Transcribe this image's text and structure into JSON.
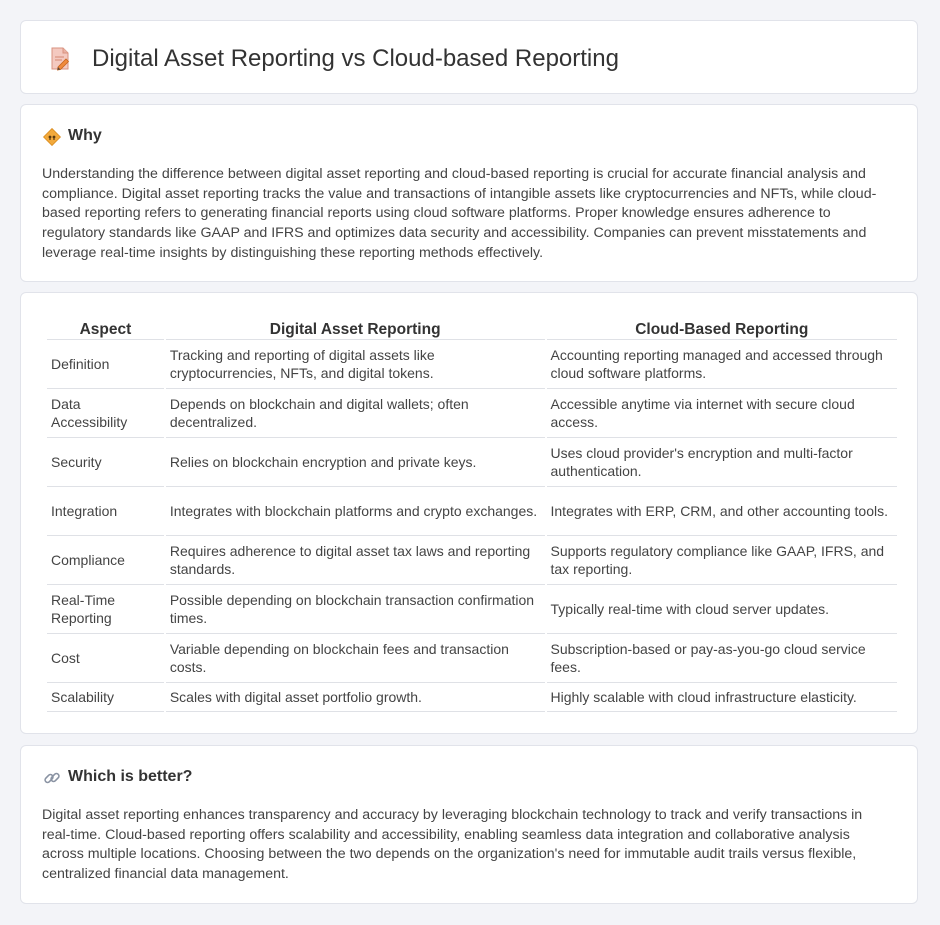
{
  "page": {
    "title": "Digital Asset Reporting vs Cloud-based Reporting"
  },
  "why": {
    "title": "Why",
    "text": "Understanding the difference between digital asset reporting and cloud-based reporting is crucial for accurate financial analysis and compliance. Digital asset reporting tracks the value and transactions of intangible assets like cryptocurrencies and NFTs, while cloud-based reporting refers to generating financial reports using cloud software platforms. Proper knowledge ensures adherence to regulatory standards like GAAP and IFRS and optimizes data security and accessibility. Companies can prevent misstatements and leverage real-time insights by distinguishing these reporting methods effectively."
  },
  "table": {
    "headers": [
      "Aspect",
      "Digital Asset Reporting",
      "Cloud-Based Reporting"
    ],
    "rows": [
      [
        "Definition",
        "Tracking and reporting of digital assets like cryptocurrencies, NFTs, and digital tokens.",
        "Accounting reporting managed and accessed through cloud software platforms."
      ],
      [
        "Data Accessibility",
        "Depends on blockchain and digital wallets; often decentralized.",
        "Accessible anytime via internet with secure cloud access."
      ],
      [
        "Security",
        "Relies on blockchain encryption and private keys.",
        "Uses cloud provider's encryption and multi-factor authentication."
      ],
      [
        "Integration",
        "Integrates with blockchain platforms and crypto exchanges.",
        "Integrates with ERP, CRM, and other accounting tools."
      ],
      [
        "Compliance",
        "Requires adherence to digital asset tax laws and reporting standards.",
        "Supports regulatory compliance like GAAP, IFRS, and tax reporting."
      ],
      [
        "Real-Time Reporting",
        "Possible depending on blockchain transaction confirmation times.",
        "Typically real-time with cloud server updates."
      ],
      [
        "Cost",
        "Variable depending on blockchain fees and transaction costs.",
        "Subscription-based or pay-as-you-go cloud service fees."
      ],
      [
        "Scalability",
        "Scales with digital asset portfolio growth.",
        "Highly scalable with cloud infrastructure elasticity."
      ]
    ]
  },
  "better": {
    "title": "Which is better?",
    "text": "Digital asset reporting enhances transparency and accuracy by leveraging blockchain technology to track and verify transactions in real-time. Cloud-based reporting offers scalability and accessibility, enabling seamless data integration and collaborative analysis across multiple locations. Choosing between the two depends on the organization's need for immutable audit trails versus flexible, centralized financial data management."
  },
  "icons": {
    "header": "document-pencil-icon",
    "why": "diamond-sign-icon",
    "better": "link-icon"
  },
  "colors": {
    "background": "#f3f4f8",
    "card": "#ffffff",
    "text": "#333333",
    "diamond": "#f2a93b",
    "link": "#8a93a3"
  }
}
